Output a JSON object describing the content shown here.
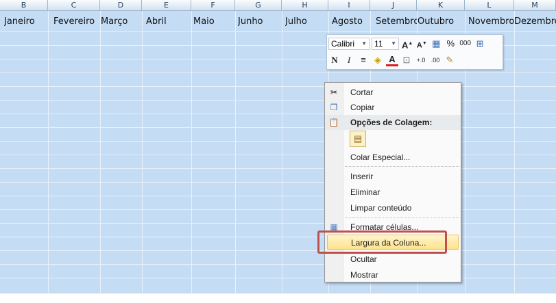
{
  "columns": [
    "B",
    "C",
    "D",
    "E",
    "F",
    "G",
    "H",
    "I",
    "J",
    "K",
    "L",
    "M"
  ],
  "months": [
    "Janeiro",
    "Fevereiro",
    "Março",
    "Abril",
    "Maio",
    "Junho",
    "Julho",
    "Agosto",
    "Setembro",
    "Outubro",
    "Novembro",
    "Dezembro"
  ],
  "mini_toolbar": {
    "font_name": "Calibri",
    "font_size": "11",
    "percent": "%",
    "thousands": "000",
    "bold": "N",
    "italic": "I"
  },
  "context_menu": {
    "items": [
      {
        "label": "Cortar"
      },
      {
        "label": "Copiar"
      },
      {
        "label": "Opções de Colagem:"
      },
      {
        "label": "Colar Especial..."
      },
      {
        "label": "Inserir"
      },
      {
        "label": "Eliminar"
      },
      {
        "label": "Limpar conteúdo"
      },
      {
        "label": "Formatar células..."
      },
      {
        "label": "Largura da Coluna..."
      },
      {
        "label": "Ocultar"
      },
      {
        "label": "Mostrar"
      }
    ]
  },
  "colors": {
    "selection_fill": "#c5dcf5",
    "highlight_border": "#c0504d",
    "hover_fill": "#fde38d"
  }
}
